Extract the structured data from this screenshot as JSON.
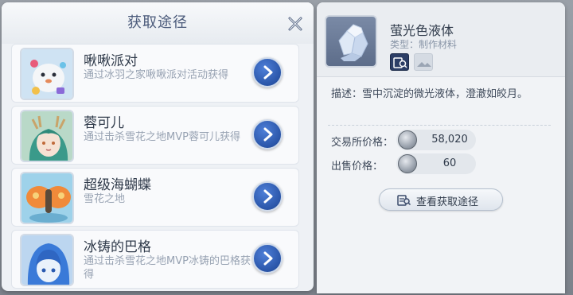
{
  "source_panel": {
    "title": "获取途径",
    "items": [
      {
        "name": "啾啾派对",
        "desc": "通过冰羽之家啾啾派对活动获得"
      },
      {
        "name": "蓉可儿",
        "desc": "通过击杀雪花之地MVP蓉可儿获得"
      },
      {
        "name": "超级海蝴蝶",
        "desc": "雪花之地"
      },
      {
        "name": "冰铸的巴格",
        "desc": "通过击杀雪花之地MVP冰铸的巴格获得"
      }
    ]
  },
  "item_panel": {
    "name": "萤光色液体",
    "type": "类型：制作材料",
    "description": "描述：雪中沉淀的微光液体，澄澈如皎月。",
    "exchange_price_label": "交易所价格：",
    "exchange_price": "58,020",
    "sell_price_label": "出售价格：",
    "sell_price": "60",
    "view_source_label": "查看获取途径"
  },
  "colors": {
    "accent_blue": "#2a55a8",
    "panel_bg": "#eef1f5",
    "title_text": "#4a5a7a"
  },
  "icons": {
    "close": "close-icon",
    "go": "chevron-right-icon",
    "coin": "zeny-coin-icon",
    "item": "crystal-liquid-icon"
  }
}
